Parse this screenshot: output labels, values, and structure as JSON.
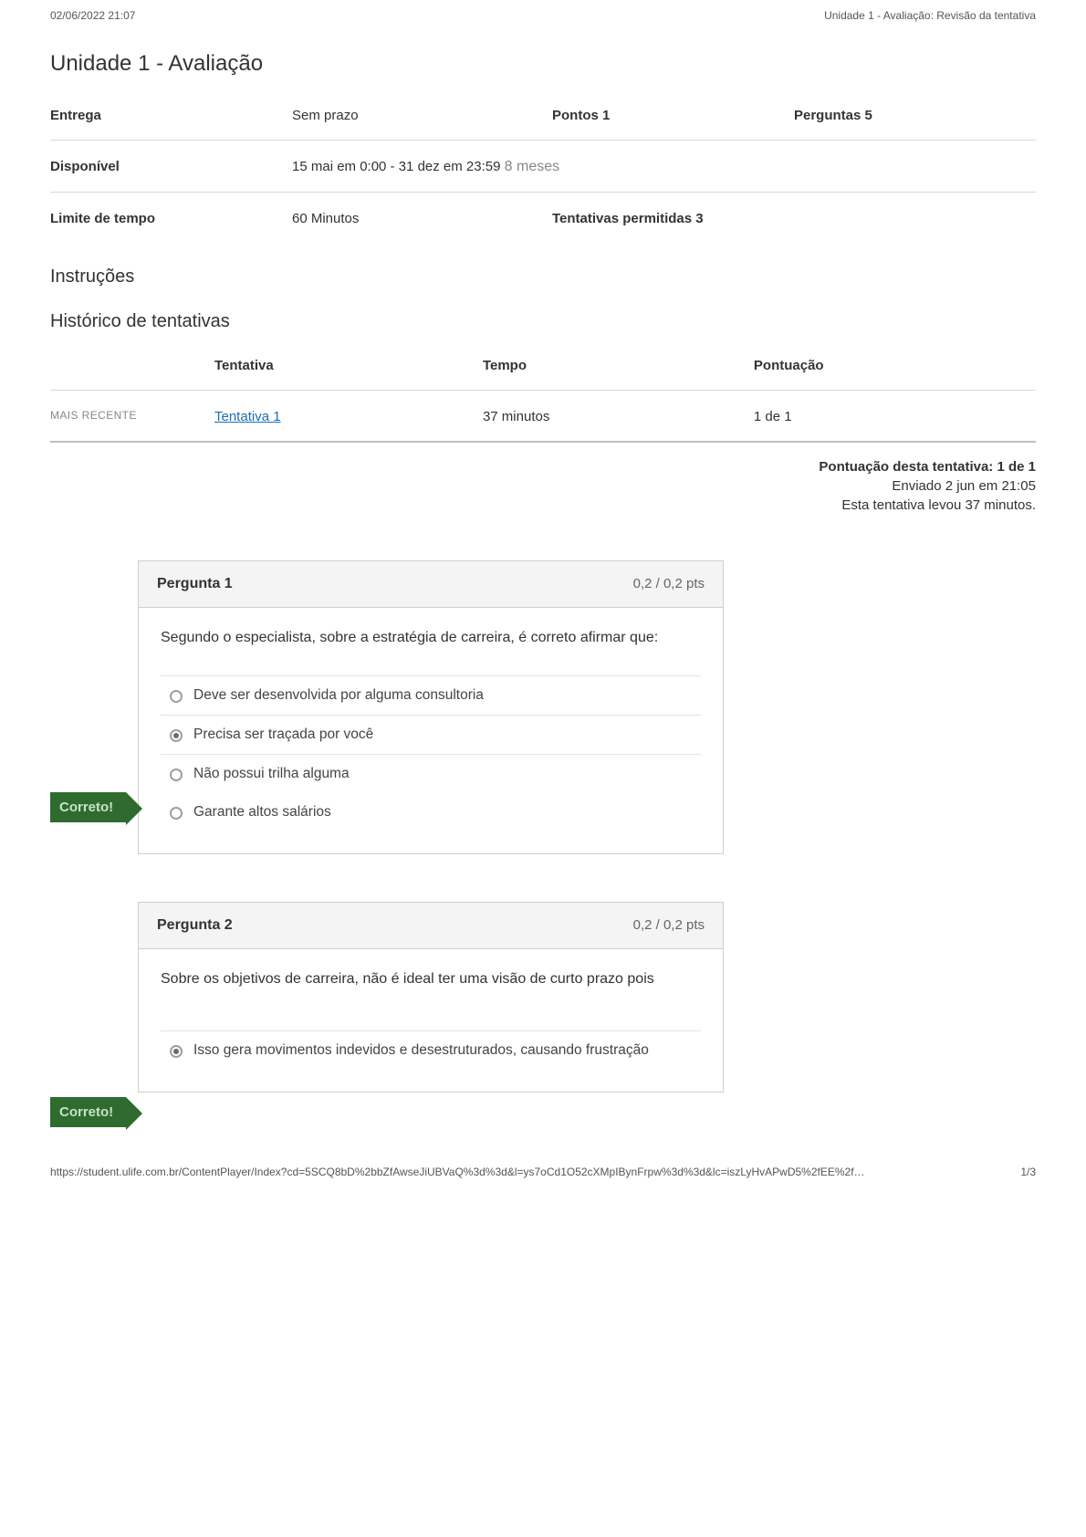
{
  "page_timestamp": "02/06/2022 21:07",
  "page_title_breadcrumb": "Unidade 1 - Avaliação: Revisão da tentativa",
  "heading": "Unidade 1 - Avaliação",
  "details": {
    "labels": {
      "due": "Entrega",
      "points": "Pontos",
      "questions": "Perguntas",
      "available": "Disponível",
      "time_limit": "Limite de tempo",
      "allowed_attempts": "Tentativas permitidas"
    },
    "values": {
      "due": "Sem prazo",
      "points": "1",
      "questions": "5",
      "available": "15 mai em 0:00 - 31 dez em 23:59",
      "available_note": "8 meses",
      "time_limit": "60 Minutos",
      "allowed_attempts": "3"
    }
  },
  "instructions_heading": "Instruções",
  "instructions_text": "",
  "attempt_history_heading": "Histórico de tentativas",
  "attempt_table": {
    "headers": [
      "",
      "Tentativa",
      "Tempo",
      "Pontuação"
    ],
    "rows": [
      [
        "MAIS RECENTE",
        "Tentativa 1",
        "37 minutos",
        "1 de 1"
      ]
    ]
  },
  "score_line": "Pontuação desta tentativa: 1 de 1",
  "submitted_line": "Enviado 2 jun em 21:05",
  "duration_line": "Esta tentativa levou 37 minutos.",
  "correct_flag": "Correto!",
  "q1": {
    "title": "Pergunta 1",
    "pts": "0,2 / 0,2 pts",
    "text": "Segundo o especialista, sobre a estratégia de carreira, é correto afirmar que:",
    "answers": [
      "Deve ser desenvolvida por alguma consultoria",
      "Precisa ser traçada por você",
      "Não possui trilha alguma",
      "Garante altos salários"
    ],
    "selected_index": 1
  },
  "q2": {
    "title": "Pergunta 2",
    "pts": "0,2 / 0,2 pts",
    "text": "Sobre os objetivos de carreira, não é ideal ter uma visão de curto prazo pois",
    "answers": [
      "Isso gera movimentos indevidos e desestruturados, causando frustração"
    ],
    "selected_index": 0
  },
  "footer_url": "https://student.ulife.com.br/ContentPlayer/Index?cd=5SCQ8bD%2bbZfAwseJiUBVaQ%3d%3d&l=ys7oCd1O52cXMpIBynFrpw%3d%3d&lc=iszLyHvAPwD5%2fEE%2f…",
  "page_number": "1/3"
}
